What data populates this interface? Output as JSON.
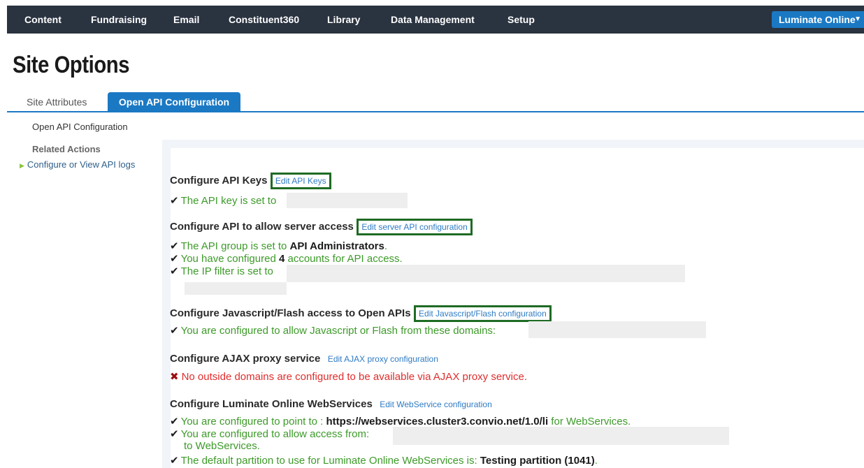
{
  "nav": {
    "items": [
      "Content",
      "Fundraising",
      "Email",
      "Constituent360",
      "Library",
      "Data Management",
      "Setup"
    ],
    "product": "Luminate Online"
  },
  "page": {
    "title": "Site Options"
  },
  "tabs": {
    "site_attributes": "Site Attributes",
    "open_api": "Open API Configuration"
  },
  "sidebar": {
    "current": "Open API Configuration",
    "related_heading": "Related Actions",
    "action": "Configure or View API logs"
  },
  "sections": {
    "keys": {
      "heading": "Configure API Keys",
      "edit": "Edit API Keys",
      "status1": "The API key is set to"
    },
    "server": {
      "heading": "Configure API to allow server access",
      "edit": "Edit server API configuration",
      "group_pre": "The API group is set to ",
      "group_value": "API Administrators",
      "group_post": ".",
      "accounts_pre": "You have configured ",
      "accounts_value": "4",
      "accounts_post": " accounts for API access.",
      "ip": "The IP filter is set to"
    },
    "js": {
      "heading": "Configure Javascript/Flash access to Open APIs",
      "edit": "Edit Javascript/Flash configuration",
      "status": "You are configured to allow Javascript or Flash from these domains:"
    },
    "ajax": {
      "heading": "Configure AJAX proxy service",
      "edit": "Edit AJAX proxy configuration",
      "error": "No outside domains are configured to be available via AJAX proxy service."
    },
    "ws": {
      "heading": "Configure Luminate Online WebServices",
      "edit": "Edit WebService configuration",
      "point_pre": "You are configured to point to : ",
      "point_value": "https://webservices.cluster3.convio.net/1.0/li",
      "point_post": " for WebServices.",
      "access_pre": "You are configured to allow access from:",
      "access_post": "to WebServices.",
      "partition_pre": "The default partition to use for Luminate Online WebServices is: ",
      "partition_value": "Testing partition (1041)",
      "partition_post": "."
    }
  }
}
